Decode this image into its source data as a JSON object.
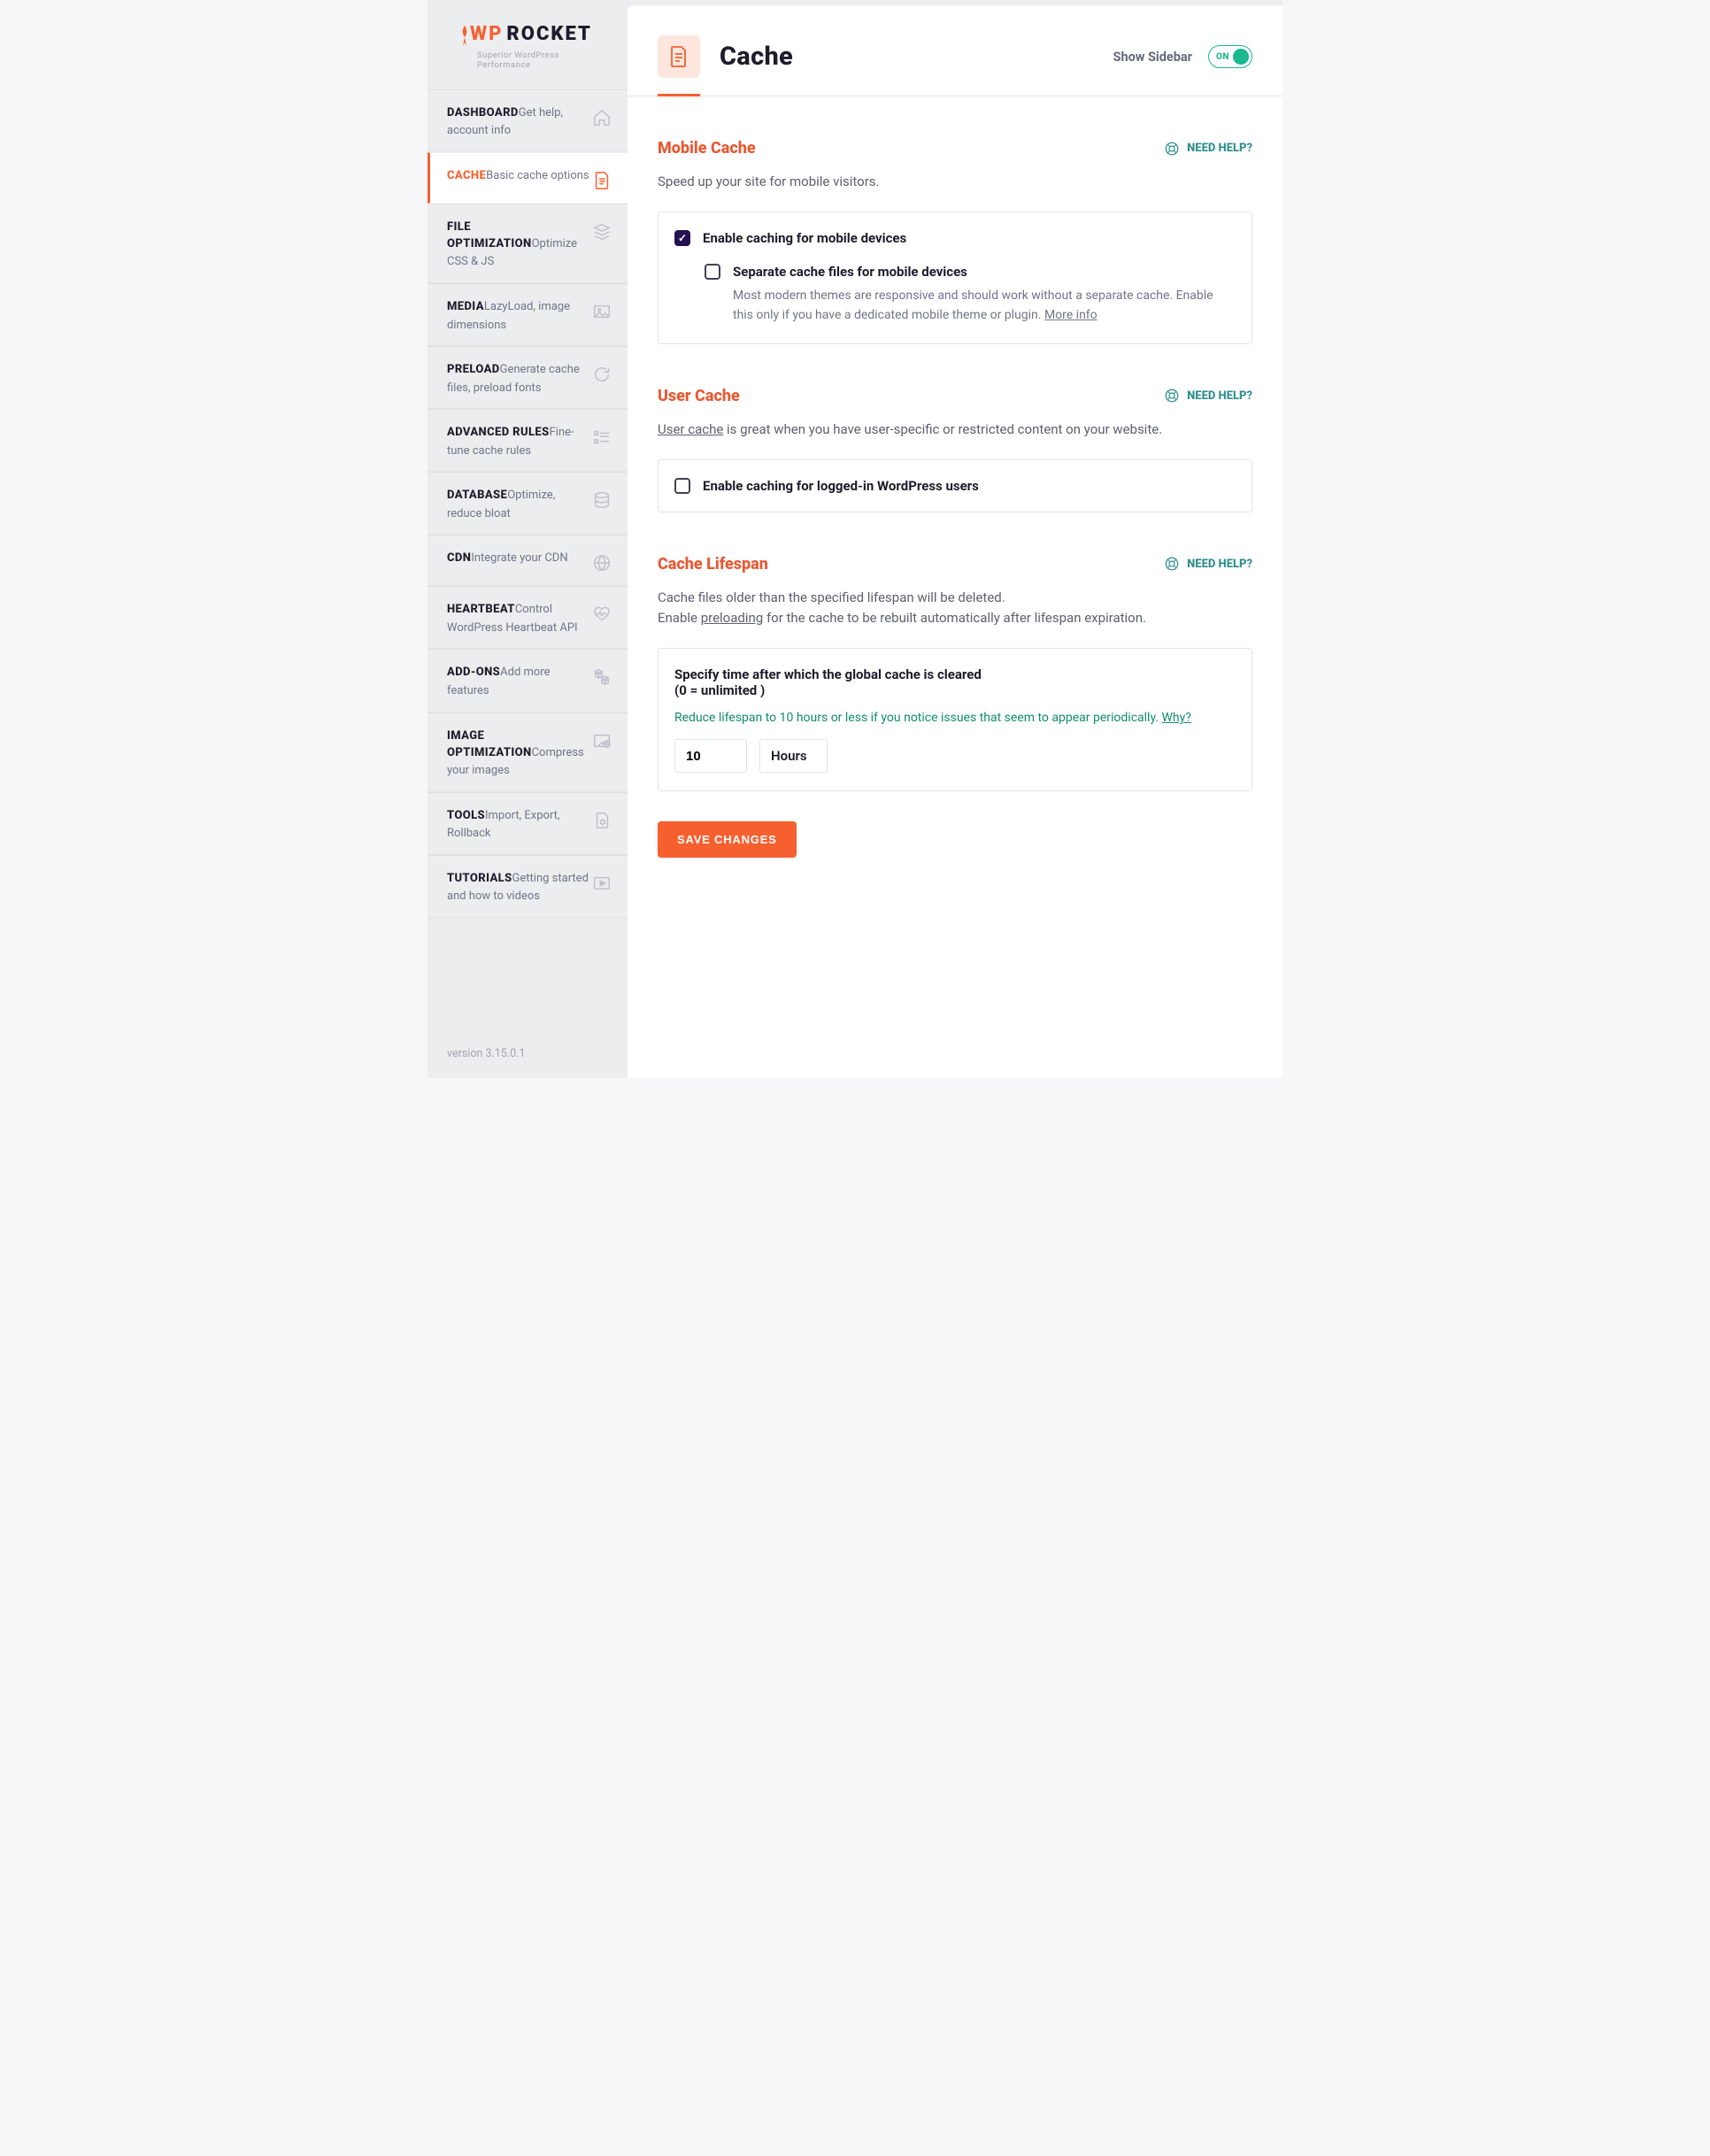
{
  "brand": {
    "wp": "WP",
    "rocket": "ROCKET",
    "tagline": "Superior WordPress Performance"
  },
  "version": "version 3.15.0.1",
  "sidebar": [
    {
      "title": "DASHBOARD",
      "desc": "Get help, account info",
      "icon": "house-icon",
      "name": "nav-dashboard"
    },
    {
      "title": "CACHE",
      "desc": "Basic cache options",
      "icon": "doc-icon",
      "name": "nav-cache",
      "active": true
    },
    {
      "title": "FILE OPTIMIZATION",
      "desc": "Optimize CSS & JS",
      "icon": "layers-icon",
      "name": "nav-file-optimization"
    },
    {
      "title": "MEDIA",
      "desc": "LazyLoad, image dimensions",
      "icon": "image-icon",
      "name": "nav-media"
    },
    {
      "title": "PRELOAD",
      "desc": "Generate cache files, preload fonts",
      "icon": "refresh-icon",
      "name": "nav-preload"
    },
    {
      "title": "ADVANCED RULES",
      "desc": "Fine-tune cache rules",
      "icon": "list-icon",
      "name": "nav-advanced-rules"
    },
    {
      "title": "DATABASE",
      "desc": "Optimize, reduce bloat",
      "icon": "database-icon",
      "name": "nav-database"
    },
    {
      "title": "CDN",
      "desc": "Integrate your CDN",
      "icon": "globe-icon",
      "name": "nav-cdn"
    },
    {
      "title": "HEARTBEAT",
      "desc": "Control WordPress Heartbeat API",
      "icon": "heartbeat-icon",
      "name": "nav-heartbeat"
    },
    {
      "title": "ADD-ONS",
      "desc": "Add more features",
      "icon": "cubes-icon",
      "name": "nav-addons"
    },
    {
      "title": "IMAGE OPTIMIZATION",
      "desc": "Compress your images",
      "icon": "compress-icon",
      "name": "nav-image-optimization"
    },
    {
      "title": "TOOLS",
      "desc": "Import, Export, Rollback",
      "icon": "gear-doc-icon",
      "name": "nav-tools"
    },
    {
      "title": "TUTORIALS",
      "desc": "Getting started and how to videos",
      "icon": "video-icon",
      "name": "nav-tutorials"
    }
  ],
  "page": {
    "title": "Cache",
    "show_sidebar": "Show Sidebar",
    "toggle_on": "ON",
    "need_help": "NEED HELP?",
    "save": "SAVE CHANGES"
  },
  "mobile_cache": {
    "title": "Mobile Cache",
    "desc": "Speed up your site for mobile visitors.",
    "opt1": "Enable caching for mobile devices",
    "opt2": "Separate cache files for mobile devices",
    "opt2_sub_a": "Most modern themes are responsive and should work without a separate cache. Enable this only if you have a dedicated mobile theme or plugin. ",
    "opt2_sub_link": "More info"
  },
  "user_cache": {
    "title": "User Cache",
    "desc_link": "User cache",
    "desc_rest": " is great when you have user-specific or restricted content on your website.",
    "opt1": "Enable caching for logged-in WordPress users"
  },
  "lifespan": {
    "title": "Cache Lifespan",
    "desc_a": "Cache files older than the specified lifespan will be deleted.",
    "desc_b_before": "Enable ",
    "desc_b_link": "preloading",
    "desc_b_after": " for the cache to be rebuilt automatically after lifespan expiration.",
    "box_label_a": "Specify time after which the global cache is cleared",
    "box_label_b": "(0 = unlimited )",
    "hint_text": "Reduce lifespan to 10 hours or less if you notice issues that seem to appear periodically. ",
    "hint_link": "Why?",
    "value": "10",
    "unit": "Hours"
  }
}
